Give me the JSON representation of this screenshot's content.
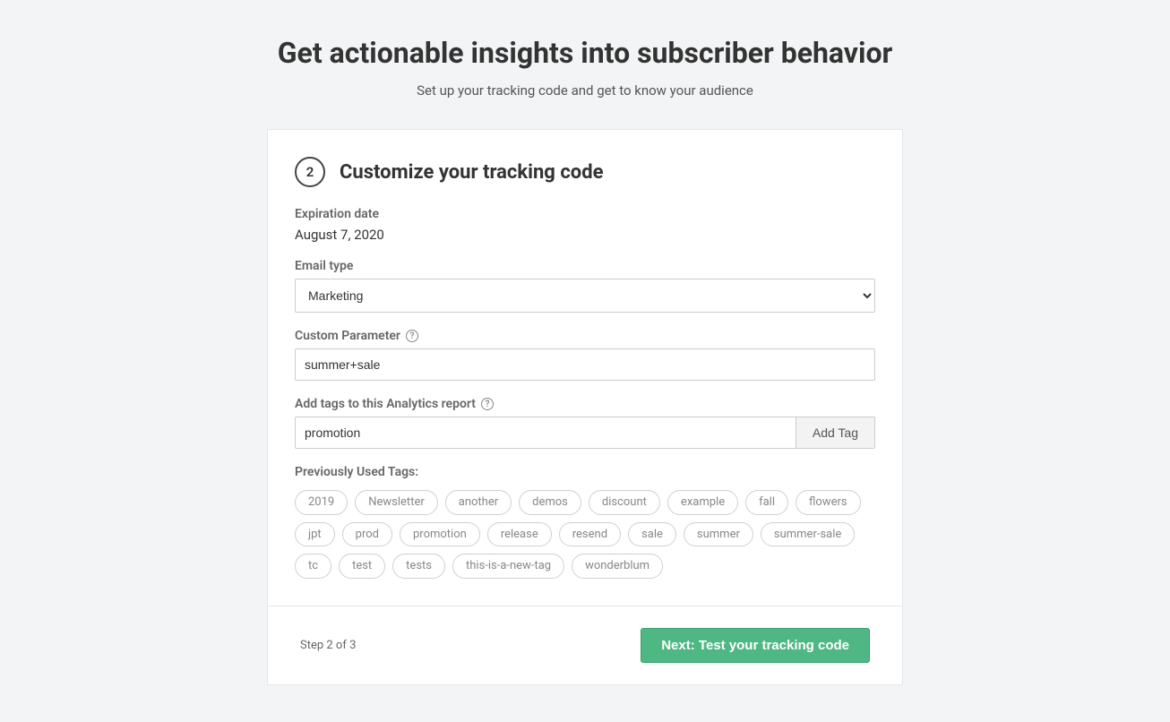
{
  "page": {
    "title": "Get actionable insights into subscriber behavior",
    "subtitle": "Set up your tracking code and get to know your audience"
  },
  "section": {
    "step_number": "2",
    "title": "Customize your tracking code"
  },
  "fields": {
    "expiration": {
      "label": "Expiration date",
      "value": "August 7, 2020"
    },
    "email_type": {
      "label": "Email type",
      "selected": "Marketing"
    },
    "custom_param": {
      "label": "Custom Parameter",
      "value": "summer+sale"
    },
    "tags_input": {
      "label": "Add tags to this Analytics report",
      "value": "promotion",
      "button": "Add Tag"
    },
    "prev_tags_label": "Previously Used Tags:"
  },
  "tags": [
    "2019",
    "Newsletter",
    "another",
    "demos",
    "discount",
    "example",
    "fall",
    "flowers",
    "jpt",
    "prod",
    "promotion",
    "release",
    "resend",
    "sale",
    "summer",
    "summer-sale",
    "tc",
    "test",
    "tests",
    "this-is-a-new-tag",
    "wonderblum"
  ],
  "footer": {
    "step_text": "Step 2 of 3",
    "next_button": "Next: Test your tracking code"
  }
}
